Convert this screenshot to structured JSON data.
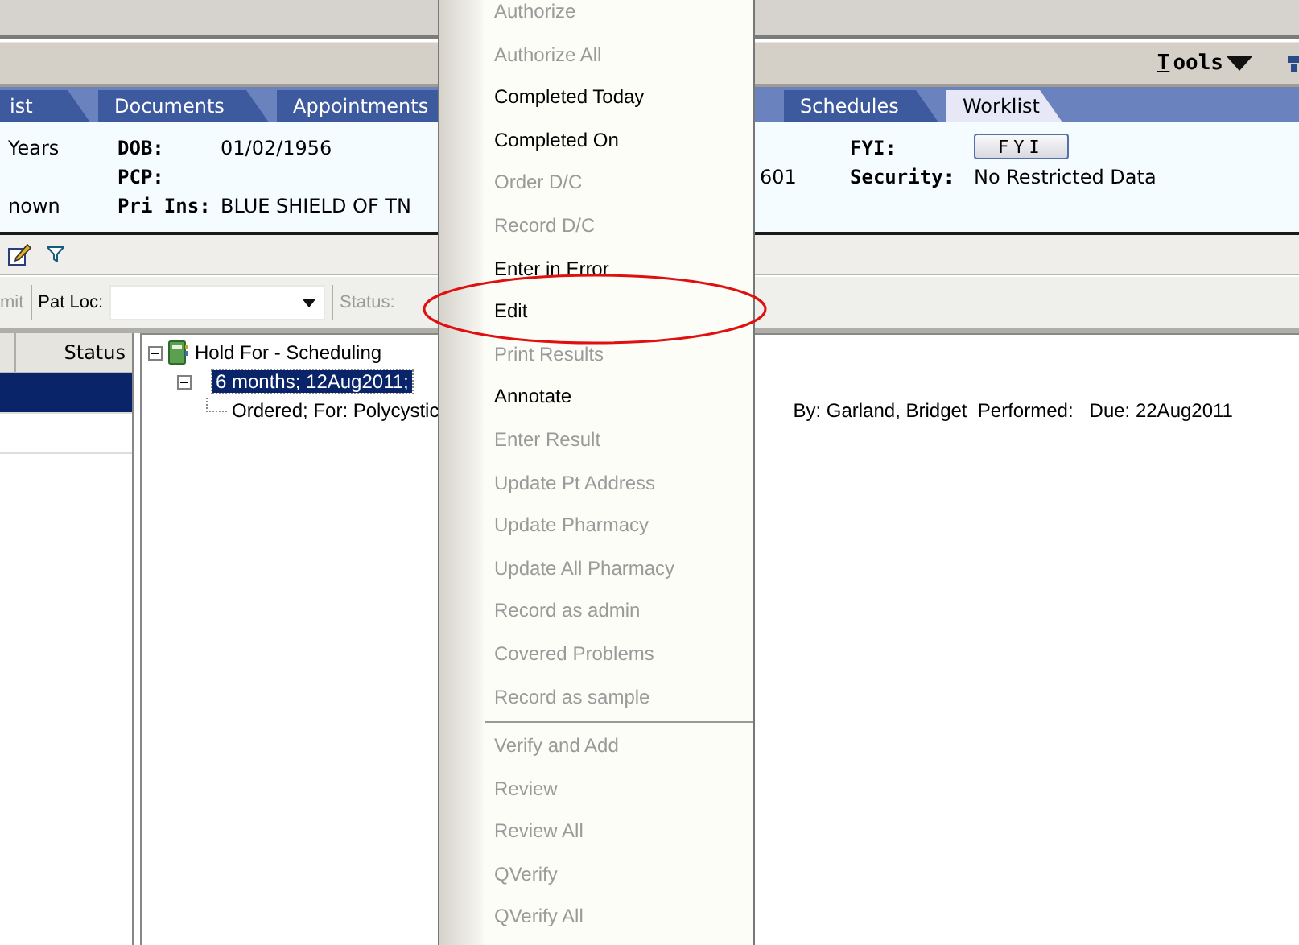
{
  "toolbar": {
    "tools_label": "Tools",
    "first_letter_underlined": true
  },
  "tabs": [
    {
      "label": "ist",
      "selected": false
    },
    {
      "label": "Documents",
      "selected": false
    },
    {
      "label": "Appointments",
      "selected": false
    },
    {
      "label": "Schedules",
      "selected": false
    },
    {
      "label": "Worklist",
      "selected": true
    }
  ],
  "patient": {
    "age": "Years",
    "column_1_row_3": "nown",
    "fields": [
      {
        "label": "DOB:",
        "value": "01/02/1956"
      },
      {
        "label": "PCP:"
      },
      {
        "label": "Pri Ins:",
        "value": "BLUE SHIELD OF TN"
      }
    ],
    "column_3_row_2": "601",
    "fyi": {
      "label": "FYI:",
      "button": "FYI"
    },
    "security": {
      "label": "Security:",
      "value": "No Restricted Data"
    }
  },
  "filter_bar": {
    "cut_label": "mit",
    "pat_loc_label": "Pat Loc:",
    "status_label": "Status:"
  },
  "orders_table": {
    "columns": [
      "Status"
    ],
    "rows": [
      {
        "selected": true
      },
      {
        "selected": false
      }
    ]
  },
  "tree": {
    "label": "Hold For - Scheduling",
    "expanded": true,
    "children": [
      {
        "label": "6 months;  12Aug2011;",
        "selected": true,
        "expanded": true,
        "children": [
          {
            "label": "Ordered; For: Polycystic",
            "detail": "By: Garland, Bridget  Performed:   Due: 22Aug2011"
          }
        ]
      }
    ]
  },
  "context_menu": {
    "groups": [
      [
        {
          "label": "Authorize",
          "disabled": true
        },
        {
          "label": "Authorize All",
          "disabled": true
        },
        {
          "label": "Completed Today",
          "disabled": false
        },
        {
          "label": "Completed On",
          "disabled": false
        },
        {
          "label": "Order D/C",
          "disabled": true
        },
        {
          "label": "Record D/C",
          "disabled": true
        },
        {
          "label": "Enter in Error",
          "disabled": false
        },
        {
          "label": "Edit",
          "disabled": false
        },
        {
          "label": "Print Results",
          "disabled": true
        },
        {
          "label": "Annotate",
          "disabled": false
        },
        {
          "label": "Enter Result",
          "disabled": true
        },
        {
          "label": "Update Pt Address",
          "disabled": true
        },
        {
          "label": "Update Pharmacy",
          "disabled": true
        },
        {
          "label": "Update All Pharmacy",
          "disabled": true
        },
        {
          "label": "Record as admin",
          "disabled": true
        },
        {
          "label": "Covered Problems",
          "disabled": true
        },
        {
          "label": "Record as sample",
          "disabled": true
        }
      ],
      [
        {
          "label": "Verify and Add",
          "disabled": true
        },
        {
          "label": "Review",
          "disabled": true
        },
        {
          "label": "Review All",
          "disabled": true
        },
        {
          "label": "QVerify",
          "disabled": true
        },
        {
          "label": "QVerify All",
          "disabled": true
        }
      ]
    ]
  }
}
